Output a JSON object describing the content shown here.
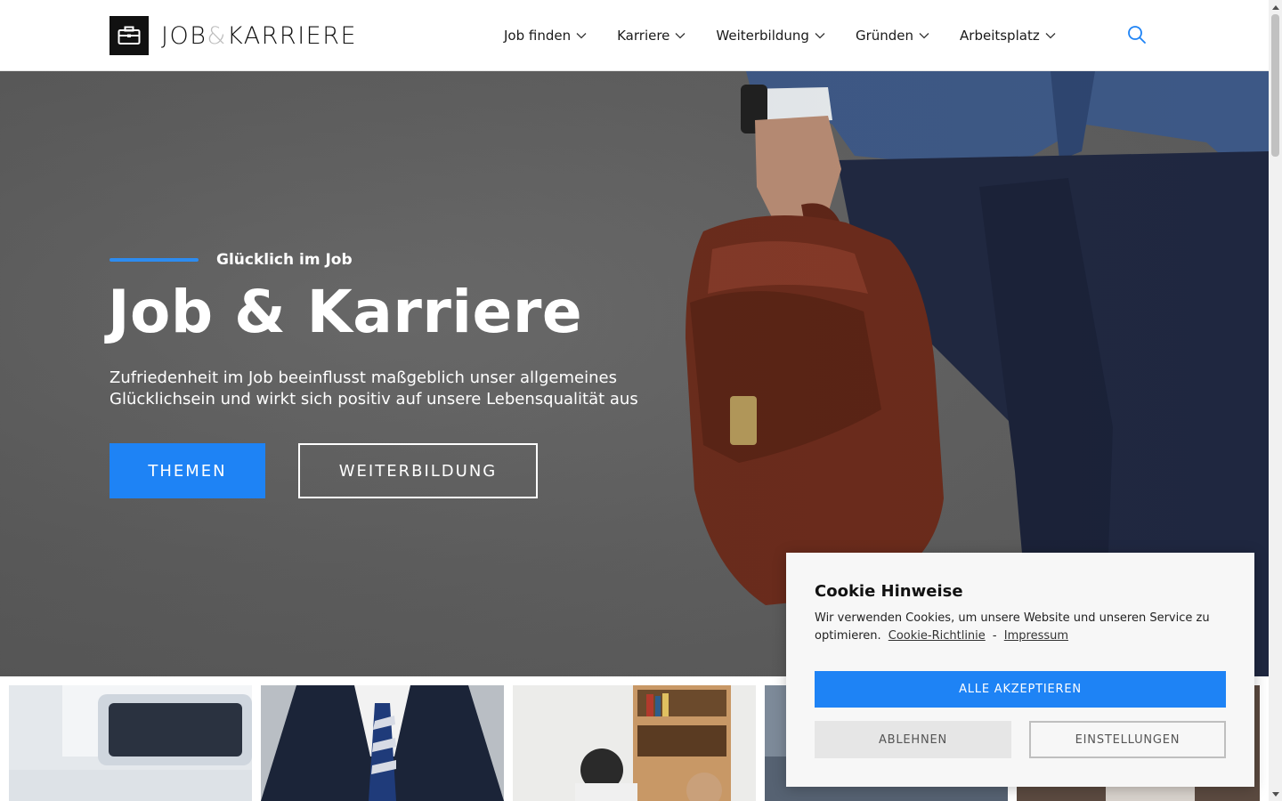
{
  "header": {
    "logo": {
      "part1": "JOB",
      "amp": "&",
      "part2": "KARRIERE",
      "icon": "briefcase-icon"
    },
    "nav": [
      {
        "label": "Job finden",
        "icon": "chevron-down-icon"
      },
      {
        "label": "Karriere",
        "icon": "chevron-down-icon"
      },
      {
        "label": "Weiterbildung",
        "icon": "chevron-down-icon"
      },
      {
        "label": "Gründen",
        "icon": "chevron-down-icon"
      },
      {
        "label": "Arbeitsplatz",
        "icon": "chevron-down-icon"
      }
    ],
    "search_icon": "search-icon"
  },
  "hero": {
    "eyebrow": "Glücklich im Job",
    "title": "Job & Karriere",
    "subtitle": "Zufriedenheit im Job beeinflusst maßgeblich unser allgemeines Glücklichsein und wirkt sich positiv auf unsere Lebensqualität aus",
    "primary_button": "THEMEN",
    "secondary_button": "WEITERBILDUNG"
  },
  "cookie": {
    "title": "Cookie Hinweise",
    "text": "Wir verwenden Cookies, um unsere Website und unseren Service zu optimieren.",
    "link_policy": "Cookie-Richtlinie",
    "separator": "-",
    "link_imprint": "Impressum",
    "accept": "ALLE AKZEPTIEREN",
    "reject": "ABLEHNEN",
    "settings": "EINSTELLUNGEN"
  },
  "colors": {
    "accent": "#1e83f5",
    "eyebrow_line": "#2d8cf0",
    "hero_bg": "#5f5f5f",
    "header_bg": "#ffffff",
    "cookie_bg": "#f7f7f7"
  }
}
